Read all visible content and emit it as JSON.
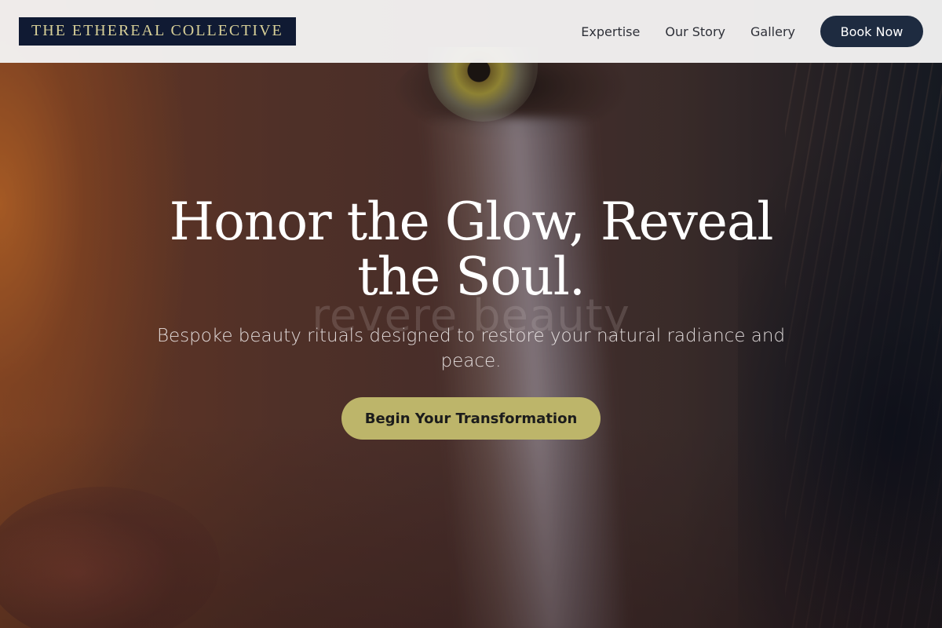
{
  "header": {
    "logo_text": "THE ETHEREAL COLLECTIVE",
    "nav": [
      {
        "label": "Expertise"
      },
      {
        "label": "Our Story"
      },
      {
        "label": "Gallery"
      }
    ],
    "book_label": "Book Now"
  },
  "hero": {
    "headline": "Honor the Glow, Reveal the Soul.",
    "watermark": "revere beauty",
    "subtitle": "Bespoke beauty rituals designed to restore your natural radiance and peace.",
    "cta_label": "Begin Your Transformation"
  },
  "colors": {
    "logo_bg": "#101a33",
    "logo_text": "#d8d098",
    "book_button_bg": "#1e2b40",
    "cta_bg": "#bdb56a",
    "header_bg": "#f4f3f3"
  },
  "icons": {
    "hero_image": "face-closeup-photo"
  }
}
